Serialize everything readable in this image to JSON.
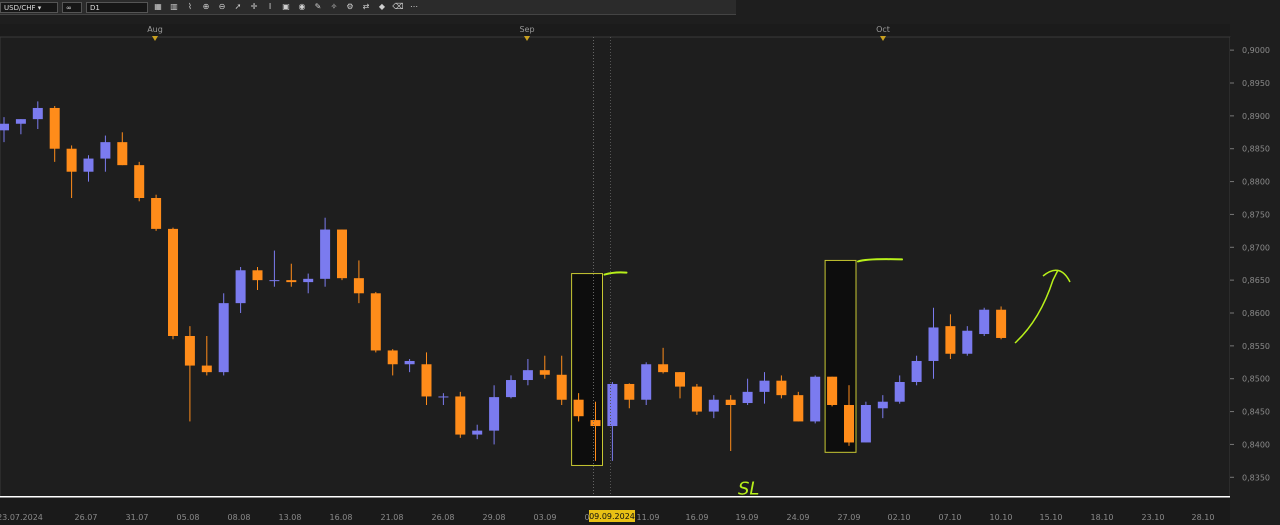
{
  "toolbar": {
    "symbol": "USD/CHF",
    "timeframe": "D1",
    "icons": [
      "chart-type-icon",
      "indicator-icon",
      "draw-line-icon",
      "zoom-in-icon",
      "zoom-out-icon",
      "cursor-icon",
      "crosshair-icon",
      "text-icon",
      "camera-icon",
      "globe-icon",
      "pencil-icon",
      "drawing-tools-icon",
      "settings-icon",
      "trade-icon",
      "alert-icon",
      "eraser-icon",
      "more-icon"
    ]
  },
  "chart_data": {
    "type": "candlestick",
    "symbol": "USD/CHF",
    "timeframe": "D1",
    "x_labels": [
      "23.07.2024",
      "26.07",
      "31.07",
      "05.08",
      "08.08",
      "13.08",
      "16.08",
      "21.08",
      "26.08",
      "29.08",
      "03.09",
      "06.09",
      "09.09.2024",
      "11.09",
      "16.09",
      "19.09",
      "24.09",
      "27.09",
      "02.10",
      "07.10",
      "10.10",
      "15.10",
      "18.10",
      "23.10",
      "28.10"
    ],
    "month_markers": [
      "Aug",
      "Sep",
      "Oct"
    ],
    "y_ticks": [
      "0,9000",
      "0,8950",
      "0,8900",
      "0,8850",
      "0,8800",
      "0,8750",
      "0,8700",
      "0,8650",
      "0,8600",
      "0,8550",
      "0,8500",
      "0,8450",
      "0,8400",
      "0,8350"
    ],
    "ylim": [
      0.832,
      0.902
    ],
    "current_price_label": "0,85620",
    "current_price": 0.8562,
    "line_price_label": "0,83204",
    "line_price": 0.83204,
    "bull_color": "#7b7bef",
    "bear_color": "#ff8c1a",
    "box_color": "#c8c832",
    "annotation_color": "#b8f01a",
    "crosshair_date": "09.09.2024",
    "candles": [
      {
        "o": 0.8878,
        "h": 0.8898,
        "l": 0.886,
        "c": 0.8888
      },
      {
        "o": 0.8888,
        "h": 0.8895,
        "l": 0.8872,
        "c": 0.8895
      },
      {
        "o": 0.8895,
        "h": 0.8922,
        "l": 0.888,
        "c": 0.8912
      },
      {
        "o": 0.8912,
        "h": 0.8915,
        "l": 0.883,
        "c": 0.885
      },
      {
        "o": 0.885,
        "h": 0.8855,
        "l": 0.8775,
        "c": 0.8815
      },
      {
        "o": 0.8815,
        "h": 0.884,
        "l": 0.88,
        "c": 0.8835
      },
      {
        "o": 0.8835,
        "h": 0.887,
        "l": 0.8815,
        "c": 0.886
      },
      {
        "o": 0.886,
        "h": 0.8875,
        "l": 0.8825,
        "c": 0.8825
      },
      {
        "o": 0.8825,
        "h": 0.883,
        "l": 0.877,
        "c": 0.8775
      },
      {
        "o": 0.8775,
        "h": 0.878,
        "l": 0.8725,
        "c": 0.8728
      },
      {
        "o": 0.8728,
        "h": 0.873,
        "l": 0.856,
        "c": 0.8565
      },
      {
        "o": 0.8565,
        "h": 0.858,
        "l": 0.8435,
        "c": 0.852
      },
      {
        "o": 0.852,
        "h": 0.8565,
        "l": 0.8505,
        "c": 0.851
      },
      {
        "o": 0.851,
        "h": 0.863,
        "l": 0.8505,
        "c": 0.8615
      },
      {
        "o": 0.8615,
        "h": 0.867,
        "l": 0.86,
        "c": 0.8665
      },
      {
        "o": 0.8665,
        "h": 0.867,
        "l": 0.8635,
        "c": 0.865
      },
      {
        "o": 0.865,
        "h": 0.8695,
        "l": 0.864,
        "c": 0.865
      },
      {
        "o": 0.865,
        "h": 0.8675,
        "l": 0.864,
        "c": 0.8647
      },
      {
        "o": 0.8647,
        "h": 0.866,
        "l": 0.863,
        "c": 0.8652
      },
      {
        "o": 0.8652,
        "h": 0.8745,
        "l": 0.864,
        "c": 0.8727
      },
      {
        "o": 0.8727,
        "h": 0.8727,
        "l": 0.865,
        "c": 0.8653
      },
      {
        "o": 0.8653,
        "h": 0.868,
        "l": 0.8615,
        "c": 0.863
      },
      {
        "o": 0.863,
        "h": 0.8632,
        "l": 0.854,
        "c": 0.8543
      },
      {
        "o": 0.8543,
        "h": 0.8545,
        "l": 0.8505,
        "c": 0.8522
      },
      {
        "o": 0.8522,
        "h": 0.853,
        "l": 0.851,
        "c": 0.8527
      },
      {
        "o": 0.8522,
        "h": 0.854,
        "l": 0.846,
        "c": 0.8473
      },
      {
        "o": 0.8473,
        "h": 0.8478,
        "l": 0.846,
        "c": 0.8473
      },
      {
        "o": 0.8473,
        "h": 0.848,
        "l": 0.841,
        "c": 0.8415
      },
      {
        "o": 0.8415,
        "h": 0.843,
        "l": 0.8408,
        "c": 0.8421
      },
      {
        "o": 0.8421,
        "h": 0.849,
        "l": 0.84,
        "c": 0.8472
      },
      {
        "o": 0.8472,
        "h": 0.8505,
        "l": 0.847,
        "c": 0.8498
      },
      {
        "o": 0.8498,
        "h": 0.853,
        "l": 0.849,
        "c": 0.8513
      },
      {
        "o": 0.8513,
        "h": 0.8535,
        "l": 0.85,
        "c": 0.8506
      },
      {
        "o": 0.8506,
        "h": 0.8535,
        "l": 0.846,
        "c": 0.8468
      },
      {
        "o": 0.8468,
        "h": 0.8478,
        "l": 0.8435,
        "c": 0.8443
      },
      {
        "o": 0.8437,
        "h": 0.8465,
        "l": 0.8375,
        "c": 0.8428
      },
      {
        "o": 0.8428,
        "h": 0.8495,
        "l": 0.8375,
        "c": 0.8492
      },
      {
        "o": 0.8492,
        "h": 0.8493,
        "l": 0.8455,
        "c": 0.8468
      },
      {
        "o": 0.8468,
        "h": 0.8525,
        "l": 0.846,
        "c": 0.8522
      },
      {
        "o": 0.8522,
        "h": 0.8547,
        "l": 0.8508,
        "c": 0.851
      },
      {
        "o": 0.851,
        "h": 0.851,
        "l": 0.847,
        "c": 0.8488
      },
      {
        "o": 0.8488,
        "h": 0.8492,
        "l": 0.8445,
        "c": 0.845
      },
      {
        "o": 0.845,
        "h": 0.8475,
        "l": 0.844,
        "c": 0.8468
      },
      {
        "o": 0.8468,
        "h": 0.8475,
        "l": 0.839,
        "c": 0.846
      },
      {
        "o": 0.8463,
        "h": 0.85,
        "l": 0.846,
        "c": 0.848
      },
      {
        "o": 0.848,
        "h": 0.851,
        "l": 0.8462,
        "c": 0.8497
      },
      {
        "o": 0.8497,
        "h": 0.8505,
        "l": 0.847,
        "c": 0.8475
      },
      {
        "o": 0.8475,
        "h": 0.848,
        "l": 0.8435,
        "c": 0.8435
      },
      {
        "o": 0.8435,
        "h": 0.8505,
        "l": 0.8432,
        "c": 0.8503
      },
      {
        "o": 0.8503,
        "h": 0.8503,
        "l": 0.8458,
        "c": 0.846
      },
      {
        "o": 0.846,
        "h": 0.849,
        "l": 0.8398,
        "c": 0.8403
      },
      {
        "o": 0.8403,
        "h": 0.8465,
        "l": 0.8403,
        "c": 0.846
      },
      {
        "o": 0.8455,
        "h": 0.8475,
        "l": 0.844,
        "c": 0.8465
      },
      {
        "o": 0.8465,
        "h": 0.8505,
        "l": 0.8462,
        "c": 0.8495
      },
      {
        "o": 0.8495,
        "h": 0.8535,
        "l": 0.849,
        "c": 0.8527
      },
      {
        "o": 0.8527,
        "h": 0.8608,
        "l": 0.85,
        "c": 0.8578
      },
      {
        "o": 0.858,
        "h": 0.8598,
        "l": 0.853,
        "c": 0.8538
      },
      {
        "o": 0.8538,
        "h": 0.858,
        "l": 0.8535,
        "c": 0.8573
      },
      {
        "o": 0.8568,
        "h": 0.8608,
        "l": 0.8565,
        "c": 0.8605
      },
      {
        "o": 0.8605,
        "h": 0.861,
        "l": 0.856,
        "c": 0.8562
      }
    ],
    "boxes": [
      {
        "from_index": 34,
        "to_index": 35,
        "high": 0.866,
        "low": 0.8368
      },
      {
        "from_index": 49,
        "to_index": 50,
        "high": 0.868,
        "low": 0.8388
      }
    ],
    "annotation_text": "SL"
  }
}
